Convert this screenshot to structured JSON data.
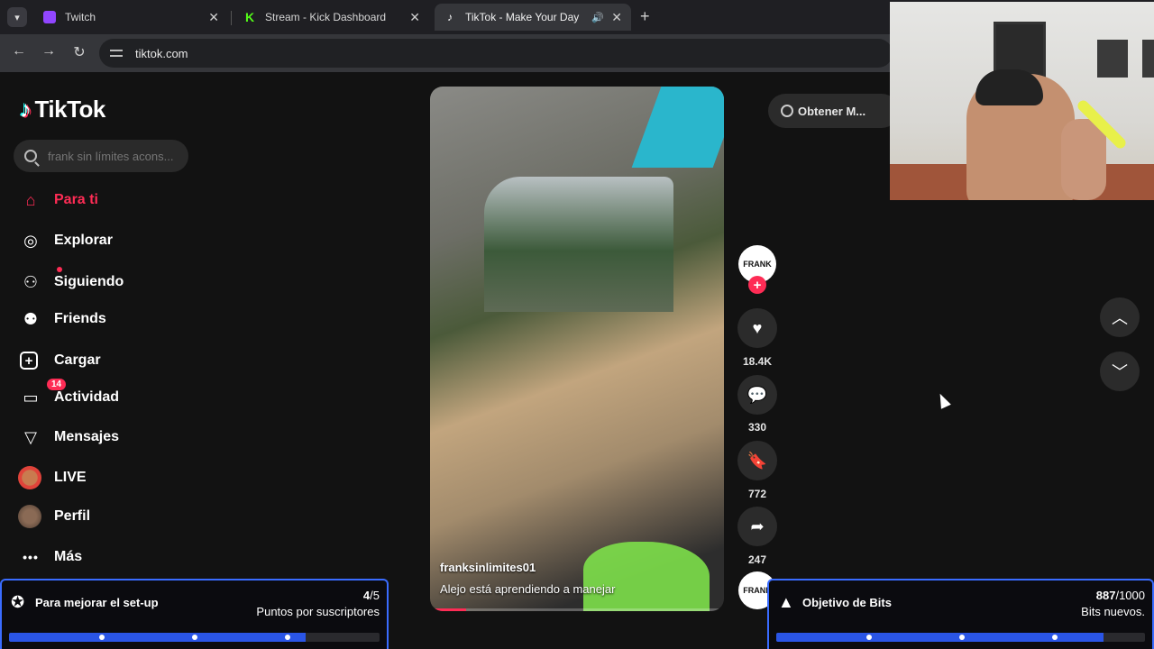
{
  "browser": {
    "tabs": [
      {
        "title": "Twitch",
        "favicon_color": "#9146ff",
        "active": false
      },
      {
        "title": "Stream - Kick Dashboard",
        "favicon_color": "#53fc18",
        "active": false
      },
      {
        "title": "TikTok - Make Your Day",
        "favicon_color": "#000000",
        "active": true
      }
    ],
    "url": "tiktok.com"
  },
  "sidebar": {
    "logo": "TikTok",
    "search_placeholder": "frank sin límites acons...",
    "items": [
      {
        "label": "Para ti",
        "icon": "home-icon",
        "active": true
      },
      {
        "label": "Explorar",
        "icon": "compass-icon"
      },
      {
        "label": "Siguiendo",
        "icon": "following-icon"
      },
      {
        "label": "Friends",
        "icon": "friends-icon"
      },
      {
        "label": "Cargar",
        "icon": "upload-icon"
      },
      {
        "label": "Actividad",
        "icon": "activity-icon",
        "badge": "14"
      },
      {
        "label": "Mensajes",
        "icon": "messages-icon"
      },
      {
        "label": "LIVE",
        "icon": "live-avatar"
      },
      {
        "label": "Perfil",
        "icon": "profile-avatar"
      },
      {
        "label": "Más",
        "icon": "more-icon"
      }
    ]
  },
  "video": {
    "username": "franksinlimites01",
    "description": "Alejo está aprendiendo a manejar"
  },
  "creator": {
    "avatar_text": "FRANK"
  },
  "actions": {
    "likes": "18.4K",
    "comments": "330",
    "saves": "772",
    "shares": "247"
  },
  "get_app": {
    "label": "Obtener M..."
  },
  "widgets": {
    "left": {
      "title": "Para mejorar el set-up",
      "count_current": "4",
      "count_total": "/5",
      "subtitle": "Puntos por suscriptores",
      "progress": 0.8
    },
    "right": {
      "title": "Objetivo de Bits",
      "count_current": "887",
      "count_total": "/1000",
      "subtitle": "Bits nuevos.",
      "progress": 0.887
    }
  },
  "colors": {
    "accent": "#fe2c55",
    "goal_border": "#3a6cff",
    "goal_fill": "#2a55e6"
  }
}
